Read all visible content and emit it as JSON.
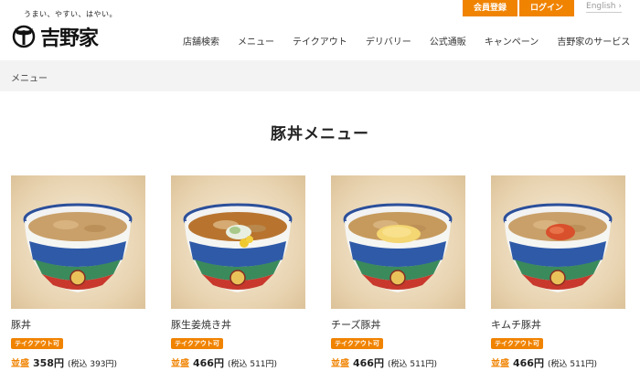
{
  "header": {
    "tagline": "うまい、やすい、はやい。",
    "logo_text": "吉野家",
    "member_register": "会員登録",
    "login": "ログイン",
    "language": "English",
    "language_chevron": "›",
    "accent_color": "#f08300"
  },
  "nav": {
    "items": [
      {
        "label": "店舗検索"
      },
      {
        "label": "メニュー"
      },
      {
        "label": "テイクアウト"
      },
      {
        "label": "デリバリー"
      },
      {
        "label": "公式通販"
      },
      {
        "label": "キャンペーン"
      },
      {
        "label": "吉野家のサービス"
      }
    ]
  },
  "breadcrumb": {
    "current": "メニュー"
  },
  "page": {
    "title": "豚丼メニュー"
  },
  "menu_items": [
    {
      "name": "豚丼",
      "badge": "テイクアウト可",
      "size": "並盛",
      "price": "358円",
      "tax_price": "(税込 393円)",
      "topping": "plain"
    },
    {
      "name": "豚生姜焼き丼",
      "badge": "テイクアウト可",
      "size": "並盛",
      "price": "466円",
      "tax_price": "(税込 511円)",
      "topping": "ginger"
    },
    {
      "name": "チーズ豚丼",
      "badge": "テイクアウト可",
      "size": "並盛",
      "price": "466円",
      "tax_price": "(税込 511円)",
      "topping": "cheese"
    },
    {
      "name": "キムチ豚丼",
      "badge": "テイクアウト可",
      "size": "並盛",
      "price": "466円",
      "tax_price": "(税込 511円)",
      "topping": "kimchi"
    }
  ]
}
